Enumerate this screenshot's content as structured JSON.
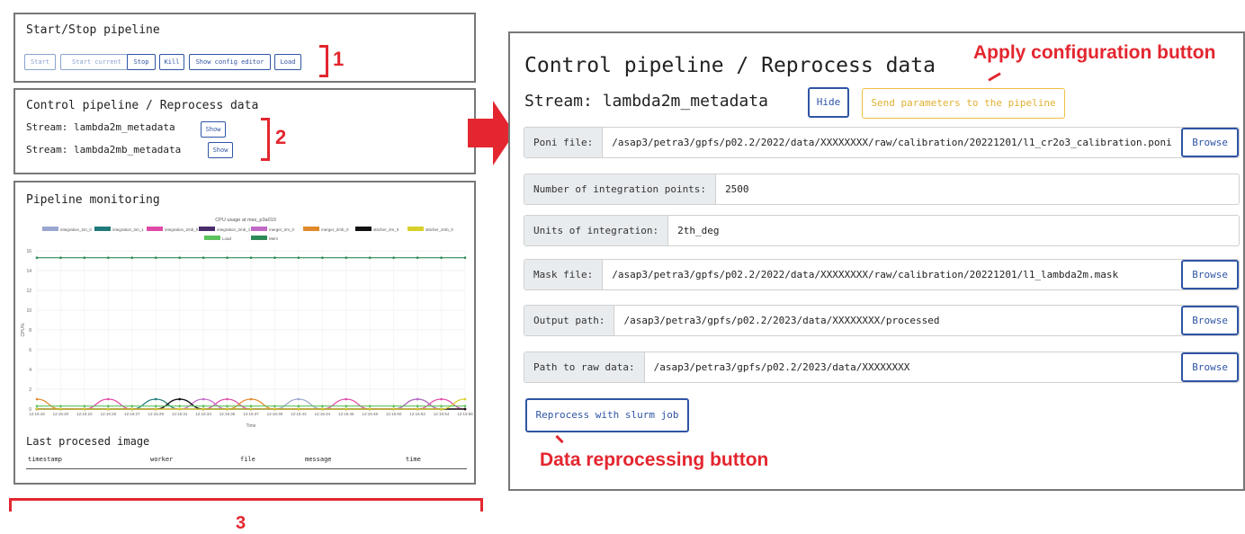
{
  "start_stop": {
    "title": "Start/Stop pipeline",
    "buttons": [
      "Start",
      "Start current",
      "Stop",
      "Kill",
      "Show config editor",
      "Load"
    ]
  },
  "control_small": {
    "title": "Control pipeline / Reprocess data",
    "streams": [
      {
        "label": "Stream: lambda2m_metadata",
        "button": "Show"
      },
      {
        "label": "Stream: lambda2mb_metadata",
        "button": "Show"
      }
    ]
  },
  "monitor": {
    "title": "Pipeline monitoring",
    "last_title": "Last procesed image",
    "table_headers": [
      "timestamp",
      "worker",
      "file",
      "message",
      "time"
    ]
  },
  "chart_data": {
    "type": "line",
    "title": "CPU usage at max_p3a010",
    "xlabel": "Time",
    "ylabel": "CPU%",
    "ylim": [
      0,
      16
    ],
    "yticks": [
      0,
      2,
      4,
      6,
      8,
      10,
      12,
      14,
      16
    ],
    "legend_position": "top",
    "x": [
      "12:15:18",
      "12:15:20",
      "12:15:22",
      "12:15:25",
      "12:15:27",
      "12:15:29",
      "12:15:31",
      "12:15:33",
      "12:15:35",
      "12:15:37",
      "12:15:39",
      "12:15:42",
      "12:15:44",
      "12:15:46",
      "12:15:48",
      "12:15:50",
      "12:15:52",
      "12:15:54",
      "12:15:56"
    ],
    "series": [
      {
        "name": "integration_2m_0",
        "color": "#9aa6cf",
        "values": [
          0,
          0,
          0,
          0,
          0,
          0,
          0,
          0,
          0,
          0,
          0,
          1,
          0,
          0,
          0,
          0,
          0,
          0,
          0
        ]
      },
      {
        "name": "integration_2m_1",
        "color": "#1f7a7a",
        "values": [
          0,
          0,
          0,
          0,
          0,
          1,
          0,
          0,
          0,
          0,
          0,
          0,
          0,
          0,
          0,
          0,
          1,
          0,
          0
        ]
      },
      {
        "name": "integration_2mb_0",
        "color": "#e04aa6",
        "values": [
          0,
          0,
          0,
          1,
          0,
          0,
          0,
          0,
          1,
          0,
          0,
          0,
          0,
          1,
          0,
          0,
          0,
          1,
          0
        ]
      },
      {
        "name": "integration_2mb_1",
        "color": "#4a2c6b",
        "values": [
          0,
          0,
          0,
          0,
          0,
          0,
          1,
          0,
          0,
          0,
          0,
          0,
          0,
          0,
          0,
          0,
          0,
          0,
          0
        ]
      },
      {
        "name": "merger_2m_0",
        "color": "#c06ac6",
        "values": [
          0,
          0,
          0,
          0,
          0,
          0,
          0,
          1,
          0,
          0,
          0,
          0,
          0,
          0,
          0,
          0,
          1,
          0,
          0
        ]
      },
      {
        "name": "merger_2mb_0",
        "color": "#e08a2c",
        "values": [
          1,
          0,
          0,
          0,
          0,
          0,
          0,
          0,
          0,
          1,
          0,
          0,
          0,
          0,
          0,
          0,
          0,
          0,
          0
        ]
      },
      {
        "name": "stitcher_2m_0",
        "color": "#111111",
        "values": [
          0,
          0,
          0,
          0,
          0,
          0,
          1,
          0,
          0,
          0,
          0,
          0,
          0,
          0,
          0,
          0,
          0,
          0,
          0
        ]
      },
      {
        "name": "stitcher_2mb_0",
        "color": "#d8d02a",
        "values": [
          0,
          0,
          0,
          0,
          0,
          0,
          0,
          0,
          0,
          0,
          0,
          0,
          0,
          0,
          0,
          0,
          0,
          0,
          1
        ]
      },
      {
        "name": "Load",
        "color": "#5cc25c",
        "values": [
          0.3,
          0.3,
          0.3,
          0.3,
          0.3,
          0.3,
          0.3,
          0.3,
          0.3,
          0.3,
          0.3,
          0.3,
          0.3,
          0.3,
          0.3,
          0.3,
          0.3,
          0.3,
          0.3
        ]
      },
      {
        "name": "Mem",
        "color": "#2e8b57",
        "values": [
          15.3,
          15.3,
          15.3,
          15.3,
          15.3,
          15.3,
          15.3,
          15.3,
          15.3,
          15.3,
          15.3,
          15.3,
          15.3,
          15.3,
          15.3,
          15.3,
          15.3,
          15.3,
          15.3
        ]
      }
    ]
  },
  "control_big": {
    "title": "Control pipeline / Reprocess data",
    "stream_label": "Stream: lambda2m_metadata",
    "hide_label": "Hide",
    "send_label": "Send parameters to the pipeline",
    "rows": [
      {
        "label": "Poni file:",
        "value": "/asap3/petra3/gpfs/p02.2/2022/data/XXXXXXXX/raw/calibration/20221201/l1_cr2o3_calibration.poni",
        "browse": "Browse"
      },
      {
        "label": "Number of integration points:",
        "value": "2500",
        "browse": ""
      },
      {
        "label": "Units of integration:",
        "value": "2th_deg",
        "browse": ""
      },
      {
        "label": "Mask file:",
        "value": "/asap3/petra3/gpfs/p02.2/2022/data/XXXXXXXX/raw/calibration/20221201/l1_lambda2m.mask",
        "browse": "Browse"
      },
      {
        "label": "Output path:",
        "value": "/asap3/petra3/gpfs/p02.2/2023/data/XXXXXXXX/processed",
        "browse": "Browse"
      },
      {
        "label": "Path to raw data:",
        "value": "/asap3/petra3/gpfs/p02.2/2023/data/XXXXXXXX",
        "browse": "Browse"
      }
    ],
    "reprocess_label": "Reprocess with slurm job"
  },
  "annotations": {
    "n1": "1",
    "n2": "2",
    "n3": "3",
    "apply": "Apply configuration button",
    "reprocess": "Data reprocessing button"
  },
  "colors": {
    "accent": "#2f55a4",
    "annotation": "#e3262f",
    "send_button": "#f0c040"
  }
}
